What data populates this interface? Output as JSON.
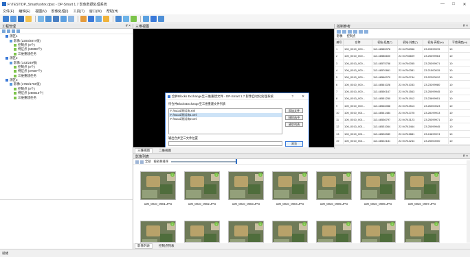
{
  "window": {
    "title": "F:\\TEST\\DP_Smart\\sohrx.dpsx - DP-Smart 1.7 影像数据处理系统",
    "min_label": "—",
    "max_label": "□",
    "close_label": "✕"
  },
  "menu": [
    "文件(F)",
    "编辑(E)",
    "视图(V)",
    "影像处理(I)",
    "工具(T)",
    "窗口(W)",
    "帮助(H)"
  ],
  "left_panel": {
    "title": "工程管理",
    "pin": "# ×",
    "tree": [
      {
        "text": "测区1",
        "indent": 1
      },
      {
        "text": "影像 (2200/2874张)",
        "indent": 2
      },
      {
        "text": "控制点 (0个)",
        "indent": 3
      },
      {
        "text": "特征点 (60898个)",
        "indent": 3
      },
      {
        "text": "三维重建任务",
        "indent": 3
      },
      {
        "text": "测区2",
        "indent": 1
      },
      {
        "text": "影像 (143/249张)",
        "indent": 2
      },
      {
        "text": "控制点 (0个)",
        "indent": 3
      },
      {
        "text": "特征点 (37507个)",
        "indent": 3
      },
      {
        "text": "三维重建任务",
        "indent": 3
      },
      {
        "text": "测区3",
        "indent": 1
      },
      {
        "text": "影像 (1768/1768张)",
        "indent": 2
      },
      {
        "text": "控制点 (0个)",
        "indent": 3
      },
      {
        "text": "特征点 (288015个)",
        "indent": 3
      },
      {
        "text": "三维重建任务",
        "indent": 3
      }
    ]
  },
  "center_panel": {
    "title": "三维视图"
  },
  "dialog": {
    "title": "合并Blocks Exchange至三维重建文件 - DP-Smart 1.7 影像自动化处理系统",
    "help": "?",
    "close": "✕",
    "list_label": "待合并BlocksExchange至三维重建文件列表",
    "files": [
      "F:/sucai/测试块.xml",
      "F:/sucai/测试块1.xml",
      "F:/sucai/测试块2.xml"
    ],
    "add_label": "添加文件",
    "remove_label": "移除选中",
    "clear_label": "清空列表",
    "output_label": "输出合并至三文件位置",
    "output_value": "",
    "browse_label": "浏览",
    "ok_label": "确定",
    "cancel_label": "取消"
  },
  "mid_tabs": [
    "三维视图",
    "二维视图"
  ],
  "right_panel": {
    "title": "控制参考",
    "pin": "# ×",
    "tabs": [
      "影像",
      "控制点"
    ],
    "columns": [
      "编号",
      "名称",
      "初始-经度(°)",
      "初始-纬度(°)",
      "初始-高程(m)",
      "平差精度(m)"
    ],
    "rows": [
      [
        "1",
        "100_0010_000...",
        "113.48585378",
        "22.94736356",
        "23.20599976",
        "10"
      ],
      [
        "2",
        "100_0010_000...",
        "113.48586600",
        "22.94736609",
        "23.25399964",
        "10"
      ],
      [
        "3",
        "100_0010_000...",
        "113.48575758",
        "22.94740055",
        "23.25399971",
        "10"
      ],
      [
        "4",
        "100_0010_000...",
        "113.48570861",
        "22.94740381",
        "23.21500015",
        "10"
      ],
      [
        "5",
        "100_0010_000...",
        "113.48560070",
        "22.94740744",
        "23.22200012",
        "10"
      ],
      [
        "6",
        "100_0010_000...",
        "113.48561028",
        "22.94741033",
        "23.23299980",
        "10"
      ],
      [
        "7",
        "100_0010_000...",
        "113.48550167",
        "22.94741563",
        "23.25099945",
        "10"
      ],
      [
        "8",
        "100_0010_000...",
        "113.48551250",
        "22.94741912",
        "23.23699951",
        "10"
      ],
      [
        "9",
        "100_0010_000...",
        "113.48546358",
        "22.94742513",
        "23.26000023",
        "10"
      ],
      [
        "10",
        "100_0010_001...",
        "113.48541484",
        "22.94742725",
        "23.28199913",
        "10"
      ],
      [
        "11",
        "100_0010_001...",
        "113.48536797",
        "22.94743123",
        "23.25399971",
        "10"
      ],
      [
        "12",
        "100_0010_001...",
        "113.48531064",
        "22.94743464",
        "23.25099945",
        "10"
      ],
      [
        "13",
        "100_0010_001...",
        "113.48526989",
        "22.94743881",
        "23.24699974",
        "10"
      ],
      [
        "19",
        "100_0010_001...",
        "113.48522181",
        "22.94744244",
        "23.25000000",
        "10"
      ]
    ]
  },
  "image_panel": {
    "title": "影像列表",
    "pin": "# ×",
    "filter_label": "全部",
    "sort_label": "按名称排序",
    "slider_value": 1.0,
    "images": [
      "100_0010_0001.JPG",
      "100_0010_0002.JPG",
      "100_0010_0003.JPG",
      "100_0010_0004.JPG",
      "100_0010_0005.JPG",
      "100_0010_0006.JPG",
      "100_0010_0007.JPG"
    ]
  },
  "bottom_tabs": [
    "影像列表",
    "控制点列表"
  ],
  "status": "就绪"
}
